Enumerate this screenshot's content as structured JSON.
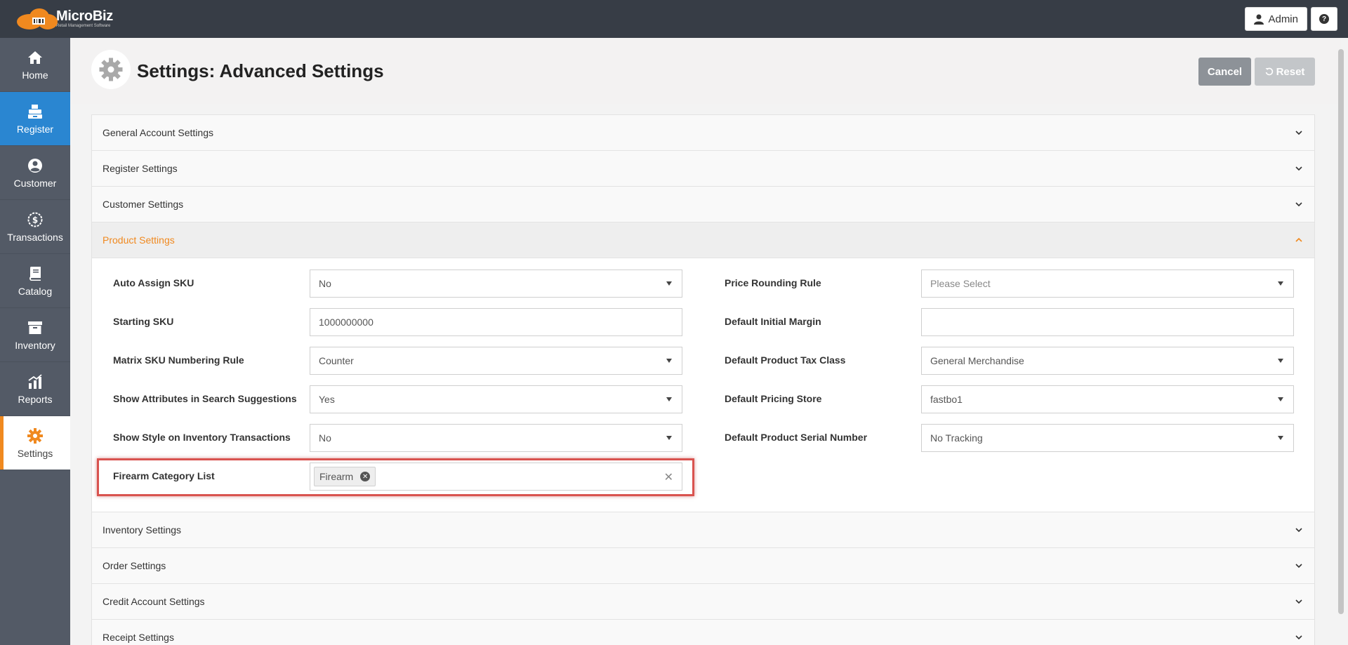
{
  "brand": {
    "name": "MicroBiz",
    "tagline": "Retail Management Software",
    "accent": "#f0891f"
  },
  "topbar": {
    "user_label": "Admin",
    "help_icon": "question-icon",
    "help_glyph": "?"
  },
  "sidebar": {
    "items": [
      {
        "label": "Home",
        "icon": "home-icon"
      },
      {
        "label": "Register",
        "icon": "register-icon"
      },
      {
        "label": "Customer",
        "icon": "user-circle-icon"
      },
      {
        "label": "Transactions",
        "icon": "dollar-circle-icon"
      },
      {
        "label": "Catalog",
        "icon": "book-icon"
      },
      {
        "label": "Inventory",
        "icon": "archive-box-icon"
      },
      {
        "label": "Reports",
        "icon": "chart-icon"
      },
      {
        "label": "Settings",
        "icon": "gear-icon"
      }
    ]
  },
  "header": {
    "title": "Settings: Advanced Settings",
    "cancel_label": "Cancel",
    "reset_label": "Reset"
  },
  "sections": {
    "general": "General Account Settings",
    "register": "Register Settings",
    "customer": "Customer Settings",
    "product": "Product Settings",
    "inventory": "Inventory Settings",
    "order": "Order Settings",
    "credit": "Credit Account Settings",
    "receipt": "Receipt Settings"
  },
  "product_settings": {
    "left": [
      {
        "label": "Auto Assign SKU",
        "value": "No"
      },
      {
        "label": "Starting SKU",
        "value": "1000000000"
      },
      {
        "label": "Matrix SKU Numbering Rule",
        "value": "Counter"
      },
      {
        "label": "Show Attributes in Search Suggestions",
        "value": "Yes"
      },
      {
        "label": "Show Style on Inventory Transactions",
        "value": "No"
      }
    ],
    "right": [
      {
        "label": "Price Rounding Rule",
        "value": "Please Select"
      },
      {
        "label": "Default Initial Margin",
        "value": ""
      },
      {
        "label": "Default Product Tax Class",
        "value": "General Merchandise"
      },
      {
        "label": "Default Pricing Store",
        "value": "fastbo1"
      },
      {
        "label": "Default Product Serial Number",
        "value": "No Tracking"
      }
    ],
    "firearm": {
      "label": "Firearm Category List",
      "chip": "Firearm"
    }
  }
}
